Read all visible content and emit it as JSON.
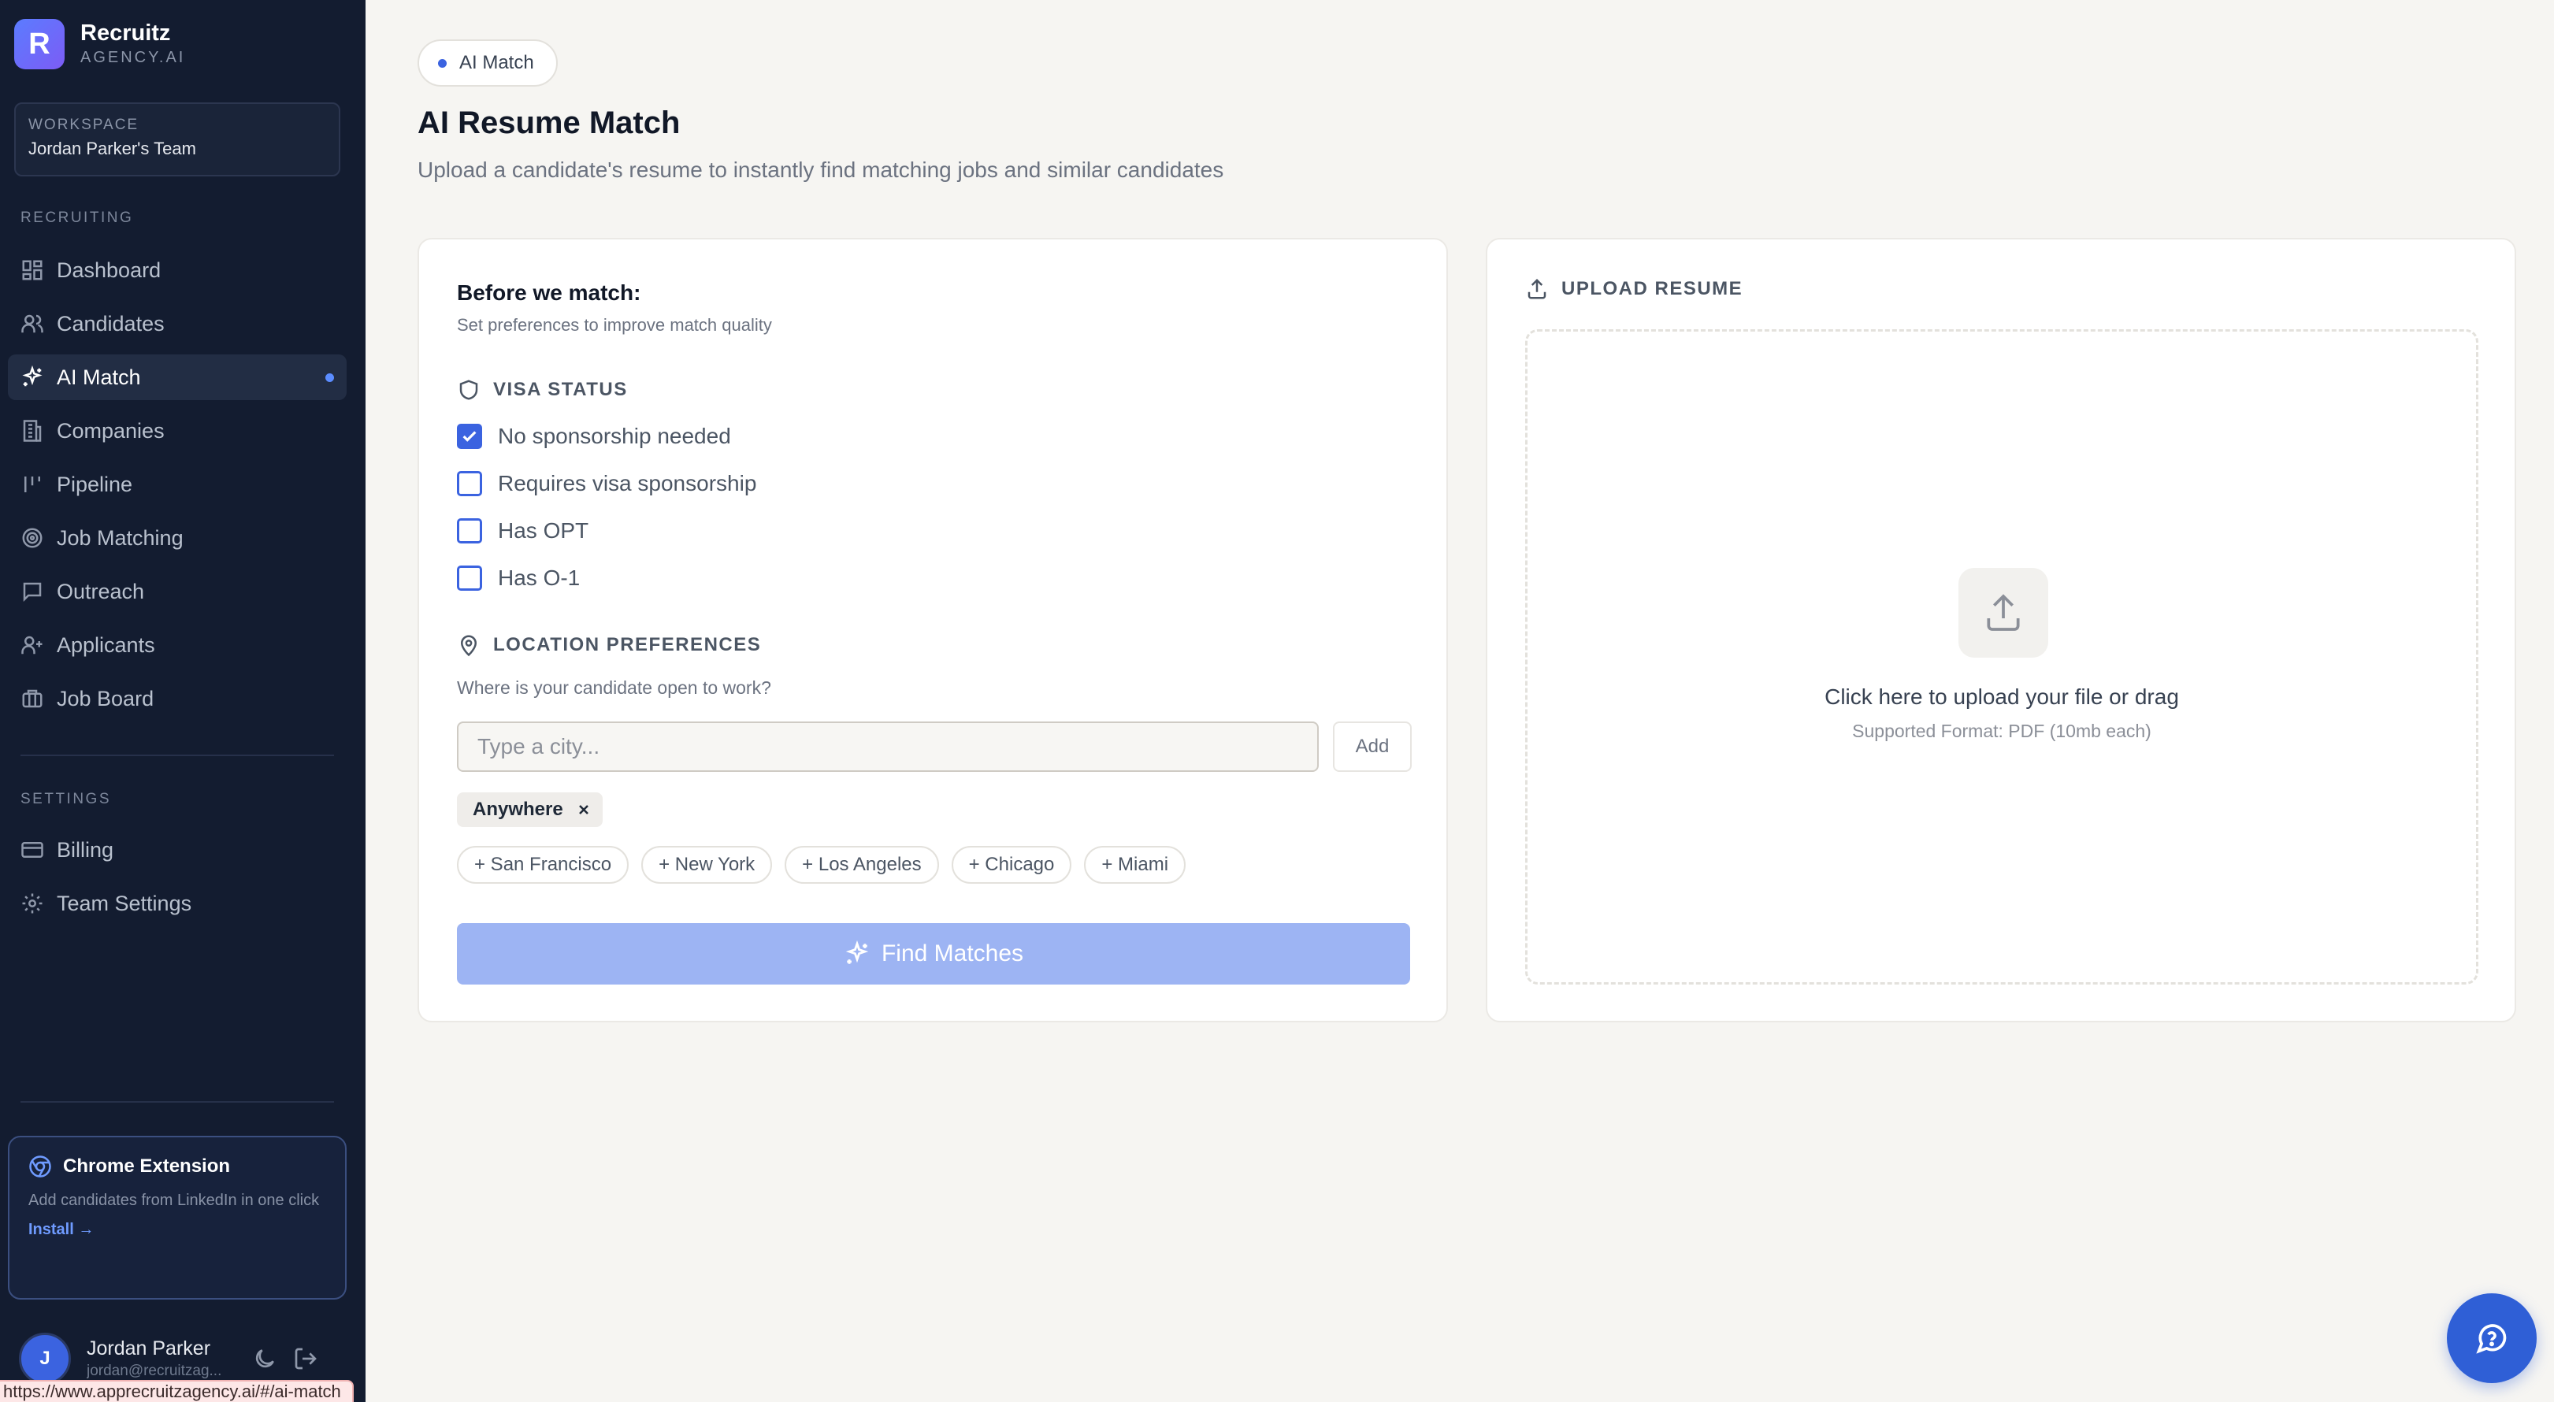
{
  "brand": {
    "name": "Recruitz",
    "sub": "AGENCY.AI",
    "logo_letter": "R",
    "accent": "#3b63e0"
  },
  "workspace": {
    "label": "WORKSPACE",
    "name": "Jordan Parker's Team"
  },
  "sidebar": {
    "recruiting_label": "RECRUITING",
    "items": [
      {
        "label": "Dashboard",
        "icon": "dashboard-icon"
      },
      {
        "label": "Candidates",
        "icon": "users-icon"
      },
      {
        "label": "AI Match",
        "icon": "sparkles-icon",
        "active": true
      },
      {
        "label": "Companies",
        "icon": "building-icon"
      },
      {
        "label": "Pipeline",
        "icon": "pipeline-icon"
      },
      {
        "label": "Job Matching",
        "icon": "target-icon"
      },
      {
        "label": "Outreach",
        "icon": "message-icon"
      },
      {
        "label": "Applicants",
        "icon": "user-plus-icon"
      },
      {
        "label": "Job Board",
        "icon": "briefcase-icon"
      }
    ],
    "settings_label": "SETTINGS",
    "settings_items": [
      {
        "label": "Billing",
        "icon": "credit-card-icon"
      },
      {
        "label": "Team Settings",
        "icon": "gear-icon"
      }
    ]
  },
  "extension": {
    "title": "Chrome Extension",
    "description": "Add candidates from LinkedIn in one click",
    "link": "Install →"
  },
  "user": {
    "initial": "J",
    "name": "Jordan Parker",
    "email": "jordan@recruitzag..."
  },
  "status_url": "https://www.apprecruitzagency.ai/#/ai-match",
  "header": {
    "pill": "AI Match",
    "title": "AI Resume Match",
    "subtitle": "Upload a candidate's resume to instantly find matching jobs and similar candidates"
  },
  "preferences": {
    "title": "Before we match:",
    "subtitle": "Set preferences to improve match quality",
    "visa_label": "VISA STATUS",
    "visa_options": [
      {
        "label": "No sponsorship needed",
        "checked": true
      },
      {
        "label": "Requires visa sponsorship",
        "checked": false
      },
      {
        "label": "Has OPT",
        "checked": false
      },
      {
        "label": "Has O-1",
        "checked": false
      }
    ],
    "location_label": "LOCATION PREFERENCES",
    "location_question": "Where is your candidate open to work?",
    "city_placeholder": "Type a city...",
    "add_label": "Add",
    "selected_locations": [
      "Anywhere"
    ],
    "suggestions": [
      "+ San Francisco",
      "+ New York",
      "+ Los Angeles",
      "+ Chicago",
      "+ Miami"
    ],
    "find_label": "Find Matches"
  },
  "upload": {
    "label": "UPLOAD RESUME",
    "drop_title": "Click here to upload your file or drag",
    "drop_sub": "Supported Format: PDF (10mb each)"
  }
}
